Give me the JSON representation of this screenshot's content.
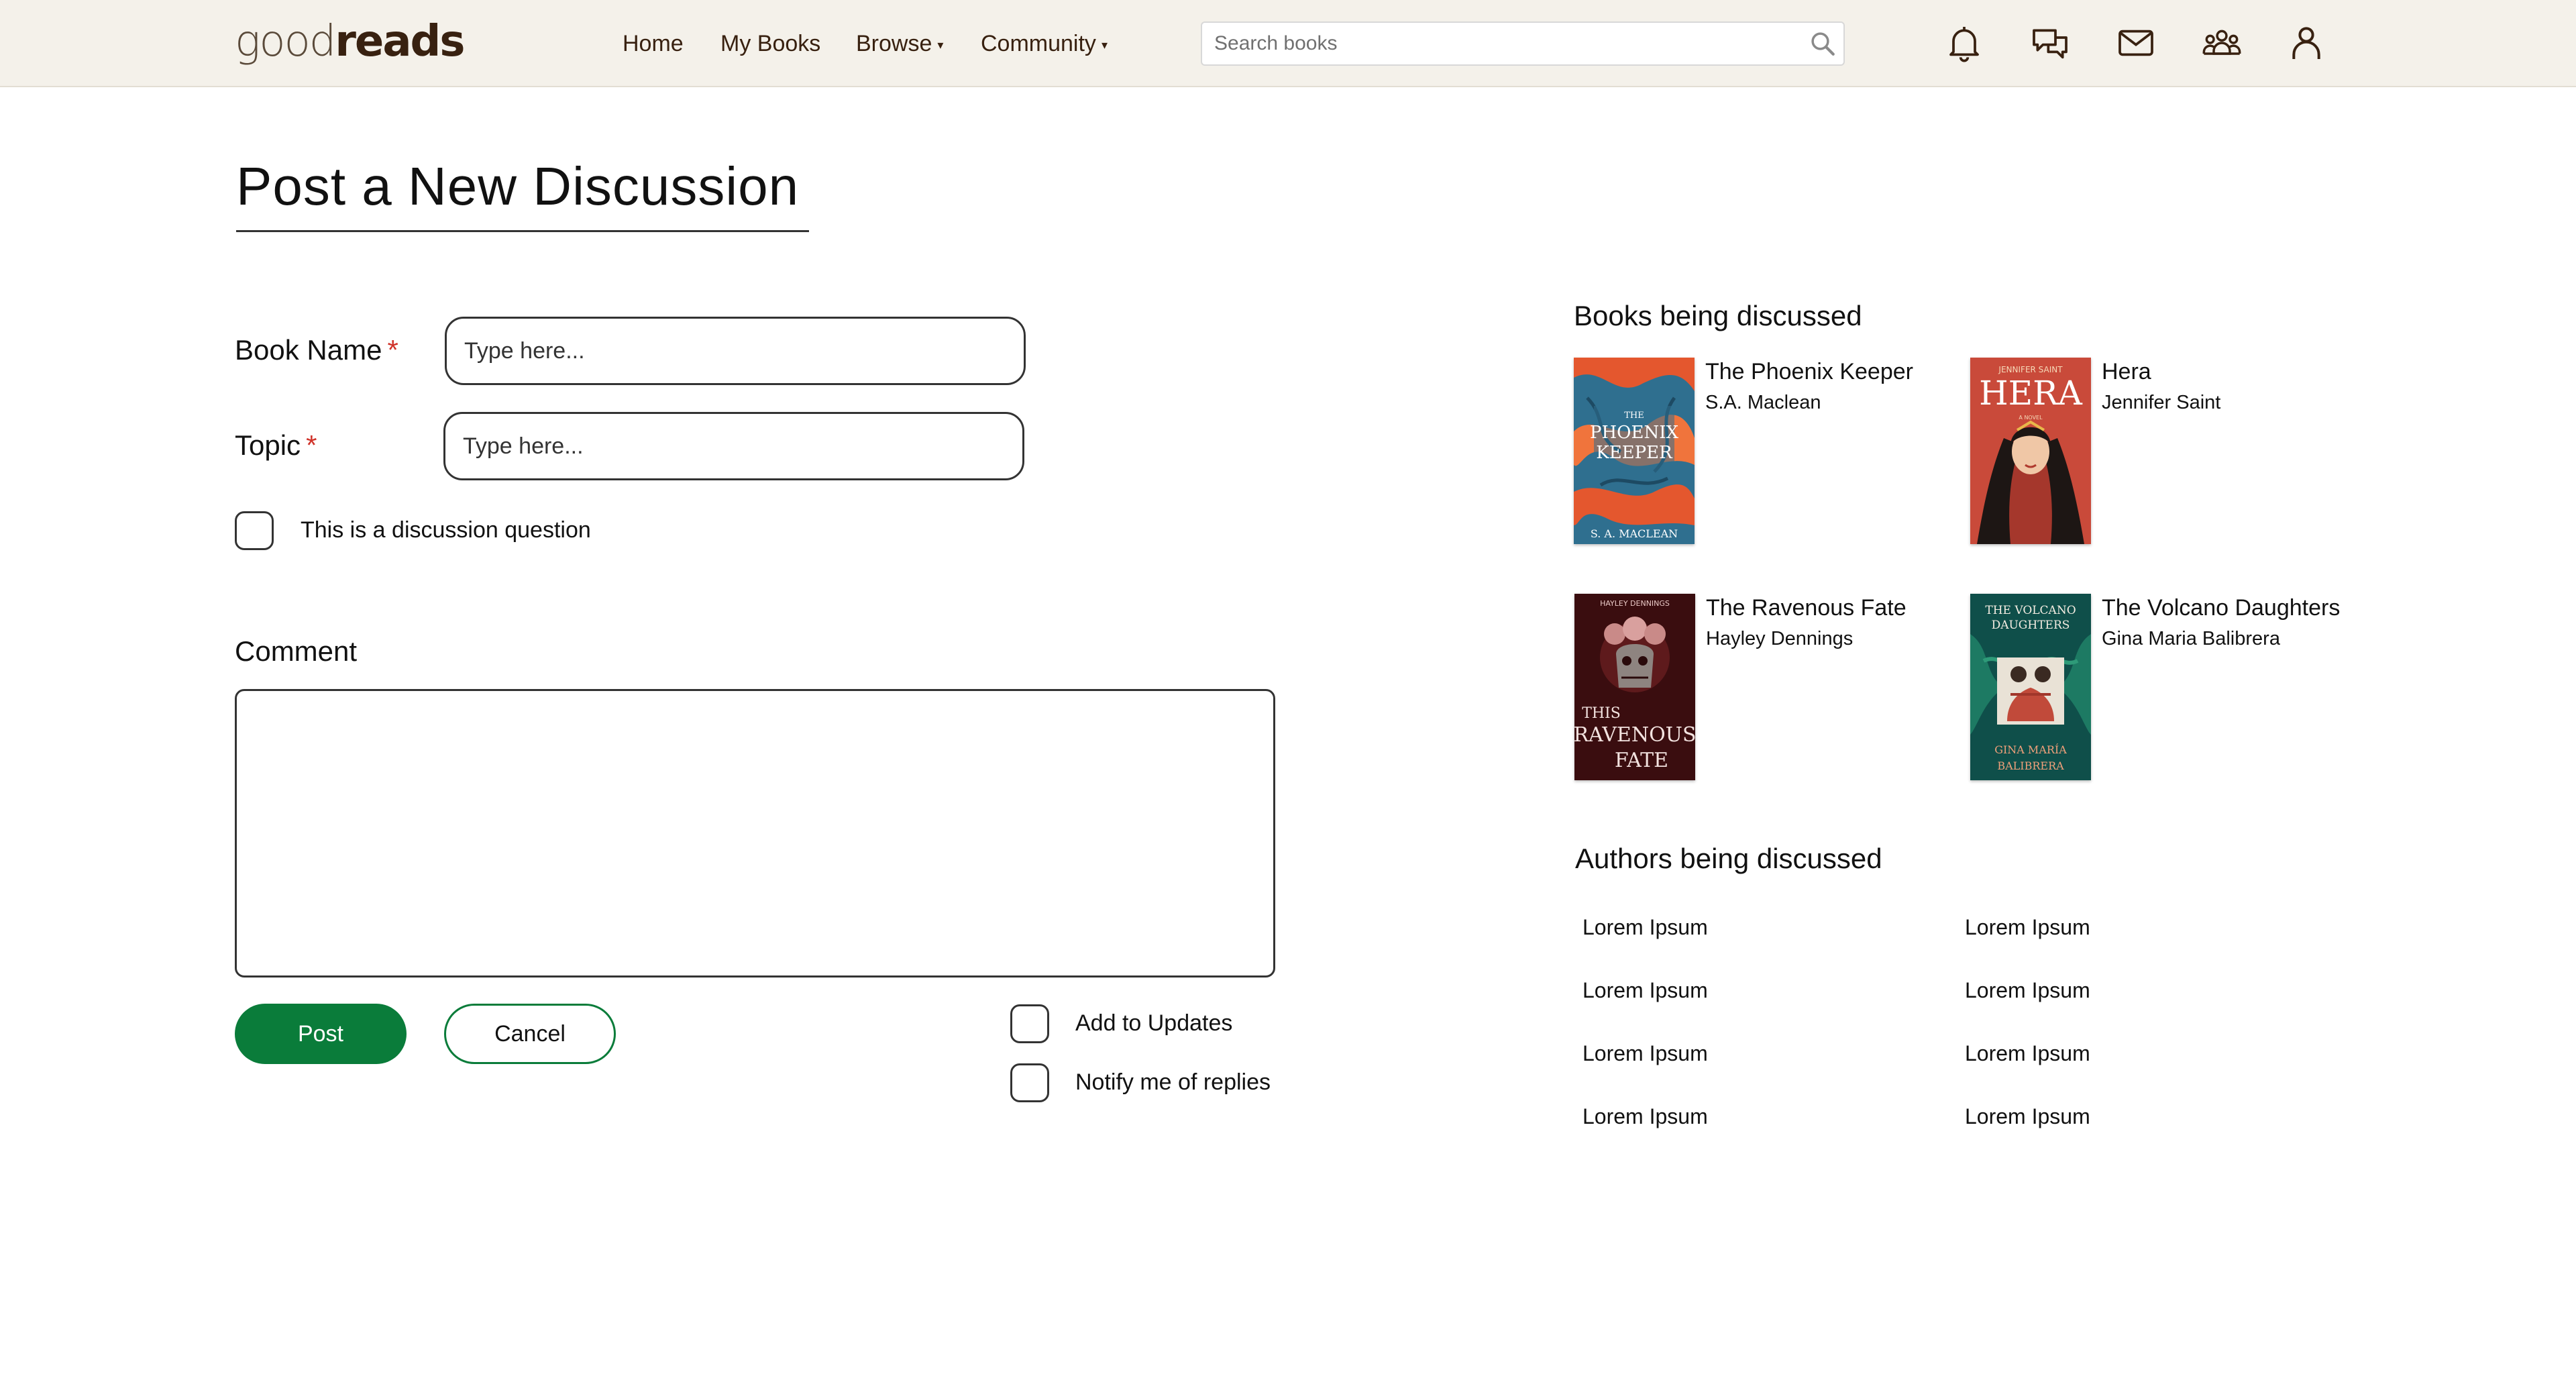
{
  "header": {
    "logo_light": "good",
    "logo_bold": "reads",
    "nav": {
      "home": "Home",
      "my_books": "My Books",
      "browse": "Browse",
      "community": "Community",
      "caret": "▾"
    },
    "search": {
      "placeholder": "Search books",
      "value": ""
    },
    "icons": [
      "bell-icon",
      "chat-icon",
      "mail-icon",
      "friends-icon",
      "profile-icon"
    ]
  },
  "form": {
    "title": "Post a New Discussion",
    "book_name": {
      "label": "Book Name",
      "required_mark": "*",
      "placeholder": "Type here...",
      "value": ""
    },
    "topic": {
      "label": "Topic",
      "required_mark": "*",
      "placeholder": "Type here...",
      "value": ""
    },
    "discussion_question": {
      "label": "This is a discussion question",
      "checked": false
    },
    "comment": {
      "label": "Comment",
      "value": ""
    },
    "post_label": "Post",
    "cancel_label": "Cancel",
    "add_to_updates": {
      "label": "Add to Updates",
      "checked": false
    },
    "notify_replies": {
      "label": "Notify me of replies",
      "checked": false
    }
  },
  "sidebar": {
    "books_heading": "Books being discussed",
    "books": [
      {
        "title": "The Phoenix Keeper",
        "author": "S.A. Maclean",
        "cover": {
          "line1": "THE",
          "line2": "PHOENIX",
          "line3": "KEEPER",
          "footer": "S. A. MACLEAN"
        }
      },
      {
        "title": "Hera",
        "author": "Jennifer Saint",
        "cover": {
          "top": "JENNIFER SAINT",
          "main": "HERA",
          "sub": "A NOVEL"
        }
      },
      {
        "title": "The Ravenous Fate",
        "author": "Hayley Dennings",
        "cover": {
          "top": "HAYLEY DENNINGS",
          "line1": "THIS",
          "line2": "RAVENOUS",
          "line3": "FATE"
        }
      },
      {
        "title": "The Volcano Daughters",
        "author": "Gina Maria Balibrera",
        "cover": {
          "line1": "THE VOLCANO",
          "line2": "DAUGHTERS",
          "footer1": "GINA MARÍA",
          "footer2": "BALIBRERA"
        }
      }
    ],
    "authors_heading": "Authors being discussed",
    "authors": [
      "Lorem Ipsum",
      "Lorem Ipsum",
      "Lorem Ipsum",
      "Lorem Ipsum",
      "Lorem Ipsum",
      "Lorem Ipsum",
      "Lorem Ipsum",
      "Lorem Ipsum"
    ]
  },
  "colors": {
    "header_bg": "#f4f1ea",
    "brand_brown": "#382110",
    "primary_green": "#0a7c3a",
    "required_red": "#d0332a"
  }
}
